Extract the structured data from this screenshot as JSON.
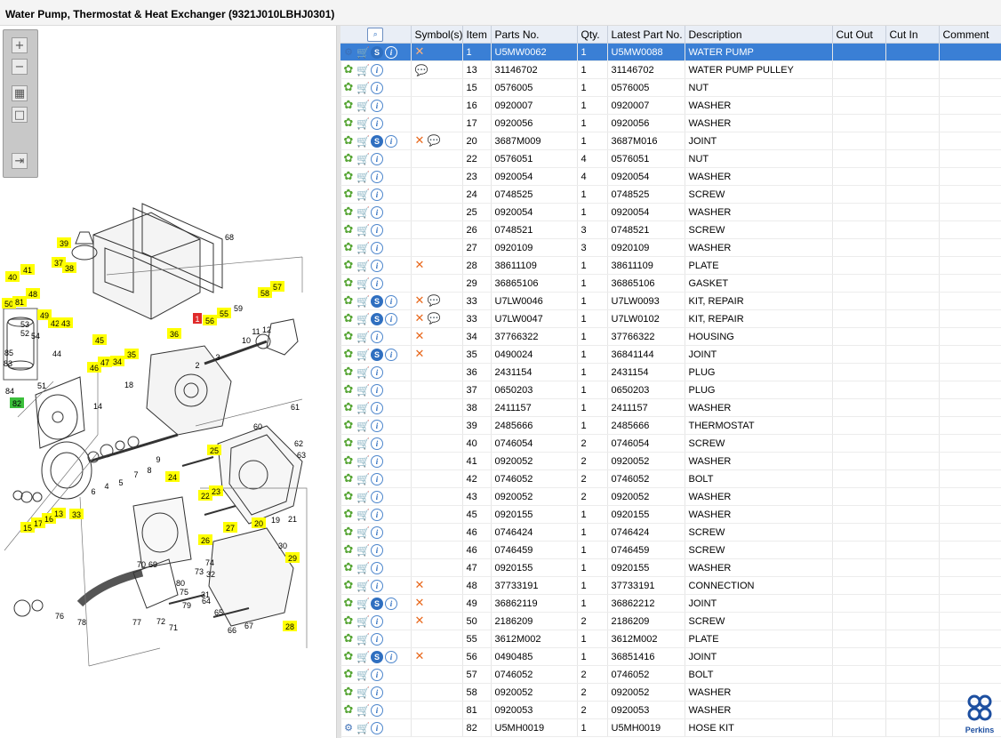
{
  "window": {
    "title": "Water Pump, Thermostat & Heat Exchanger (9321J010LBHJ0301)"
  },
  "toolbar": {
    "zoom_in_icon": "zoom-in-icon",
    "zoom_out_icon": "zoom-out-icon",
    "fit_icon": "fit-page-icon",
    "actual_icon": "actual-size-icon",
    "export_icon": "export-icon"
  },
  "diagram": {
    "highlighted_callouts": [
      "39",
      "41",
      "37",
      "38",
      "40",
      "48",
      "50",
      "81",
      "49",
      "42",
      "43",
      "45",
      "46",
      "47",
      "34",
      "35",
      "36",
      "56",
      "55",
      "58",
      "57",
      "82",
      "24",
      "25",
      "22",
      "23",
      "26",
      "27",
      "20",
      "29",
      "28",
      "15",
      "17",
      "16",
      "13",
      "33"
    ],
    "red_callout": "1",
    "plain_callouts": [
      "68",
      "59",
      "53",
      "52",
      "83",
      "84",
      "85",
      "51",
      "44",
      "54",
      "14",
      "18",
      "2",
      "3",
      "10",
      "11",
      "12",
      "4",
      "5",
      "6",
      "7",
      "8",
      "9",
      "61",
      "60",
      "62",
      "63",
      "19",
      "21",
      "30",
      "31",
      "32",
      "70",
      "69",
      "74",
      "73",
      "80",
      "64",
      "65",
      "66",
      "67",
      "71",
      "72",
      "75",
      "76",
      "77",
      "78",
      "79"
    ],
    "highlight_color": "#ffff00",
    "green_color": "#3bbf3b"
  },
  "table": {
    "headers": {
      "actions": "",
      "symbols": "Symbol(s)",
      "item": "Item",
      "parts_no": "Parts No.",
      "qty": "Qty.",
      "latest_part_no": "Latest Part No.",
      "description": "Description",
      "cut_out": "Cut Out",
      "cut_in": "Cut In",
      "comment": "Comment"
    },
    "rows": [
      {
        "item": "1",
        "parts_no": "U5MW0062",
        "qty": "1",
        "latest": "U5MW0088",
        "desc": "WATER PUMP",
        "s": true,
        "x": true,
        "p": false,
        "gear": "multi",
        "selected": true
      },
      {
        "item": "13",
        "parts_no": "31146702",
        "qty": "1",
        "latest": "31146702",
        "desc": "WATER PUMP PULLEY",
        "s": false,
        "x": false,
        "p": true,
        "gear": "single"
      },
      {
        "item": "15",
        "parts_no": "0576005",
        "qty": "1",
        "latest": "0576005",
        "desc": "NUT",
        "s": false,
        "x": false,
        "p": false,
        "gear": "single"
      },
      {
        "item": "16",
        "parts_no": "0920007",
        "qty": "1",
        "latest": "0920007",
        "desc": "WASHER",
        "s": false,
        "x": false,
        "p": false,
        "gear": "single"
      },
      {
        "item": "17",
        "parts_no": "0920056",
        "qty": "1",
        "latest": "0920056",
        "desc": "WASHER",
        "s": false,
        "x": false,
        "p": false,
        "gear": "single"
      },
      {
        "item": "20",
        "parts_no": "3687M009",
        "qty": "1",
        "latest": "3687M016",
        "desc": "JOINT",
        "s": true,
        "x": true,
        "p": true,
        "gear": "single"
      },
      {
        "item": "22",
        "parts_no": "0576051",
        "qty": "4",
        "latest": "0576051",
        "desc": "NUT",
        "s": false,
        "x": false,
        "p": false,
        "gear": "single"
      },
      {
        "item": "23",
        "parts_no": "0920054",
        "qty": "4",
        "latest": "0920054",
        "desc": "WASHER",
        "s": false,
        "x": false,
        "p": false,
        "gear": "single"
      },
      {
        "item": "24",
        "parts_no": "0748525",
        "qty": "1",
        "latest": "0748525",
        "desc": "SCREW",
        "s": false,
        "x": false,
        "p": false,
        "gear": "single"
      },
      {
        "item": "25",
        "parts_no": "0920054",
        "qty": "1",
        "latest": "0920054",
        "desc": "WASHER",
        "s": false,
        "x": false,
        "p": false,
        "gear": "single"
      },
      {
        "item": "26",
        "parts_no": "0748521",
        "qty": "3",
        "latest": "0748521",
        "desc": "SCREW",
        "s": false,
        "x": false,
        "p": false,
        "gear": "single"
      },
      {
        "item": "27",
        "parts_no": "0920109",
        "qty": "3",
        "latest": "0920109",
        "desc": "WASHER",
        "s": false,
        "x": false,
        "p": false,
        "gear": "single"
      },
      {
        "item": "28",
        "parts_no": "38611109",
        "qty": "1",
        "latest": "38611109",
        "desc": "PLATE",
        "s": false,
        "x": true,
        "p": false,
        "gear": "single"
      },
      {
        "item": "29",
        "parts_no": "36865106",
        "qty": "1",
        "latest": "36865106",
        "desc": "GASKET",
        "s": false,
        "x": false,
        "p": false,
        "gear": "single"
      },
      {
        "item": "33",
        "parts_no": "U7LW0046",
        "qty": "1",
        "latest": "U7LW0093",
        "desc": "KIT, REPAIR",
        "s": true,
        "x": true,
        "p": true,
        "gear": "single"
      },
      {
        "item": "33",
        "parts_no": "U7LW0047",
        "qty": "1",
        "latest": "U7LW0102",
        "desc": "KIT, REPAIR",
        "s": true,
        "x": true,
        "p": true,
        "gear": "single"
      },
      {
        "item": "34",
        "parts_no": "37766322",
        "qty": "1",
        "latest": "37766322",
        "desc": "HOUSING",
        "s": false,
        "x": true,
        "p": false,
        "gear": "single"
      },
      {
        "item": "35",
        "parts_no": "0490024",
        "qty": "1",
        "latest": "36841144",
        "desc": "JOINT",
        "s": true,
        "x": true,
        "p": false,
        "gear": "single"
      },
      {
        "item": "36",
        "parts_no": "2431154",
        "qty": "1",
        "latest": "2431154",
        "desc": "PLUG",
        "s": false,
        "x": false,
        "p": false,
        "gear": "single"
      },
      {
        "item": "37",
        "parts_no": "0650203",
        "qty": "1",
        "latest": "0650203",
        "desc": "PLUG",
        "s": false,
        "x": false,
        "p": false,
        "gear": "single"
      },
      {
        "item": "38",
        "parts_no": "2411157",
        "qty": "1",
        "latest": "2411157",
        "desc": "WASHER",
        "s": false,
        "x": false,
        "p": false,
        "gear": "single"
      },
      {
        "item": "39",
        "parts_no": "2485666",
        "qty": "1",
        "latest": "2485666",
        "desc": "THERMOSTAT",
        "s": false,
        "x": false,
        "p": false,
        "gear": "single"
      },
      {
        "item": "40",
        "parts_no": "0746054",
        "qty": "2",
        "latest": "0746054",
        "desc": "SCREW",
        "s": false,
        "x": false,
        "p": false,
        "gear": "single"
      },
      {
        "item": "41",
        "parts_no": "0920052",
        "qty": "2",
        "latest": "0920052",
        "desc": "WASHER",
        "s": false,
        "x": false,
        "p": false,
        "gear": "single"
      },
      {
        "item": "42",
        "parts_no": "0746052",
        "qty": "2",
        "latest": "0746052",
        "desc": "BOLT",
        "s": false,
        "x": false,
        "p": false,
        "gear": "single"
      },
      {
        "item": "43",
        "parts_no": "0920052",
        "qty": "2",
        "latest": "0920052",
        "desc": "WASHER",
        "s": false,
        "x": false,
        "p": false,
        "gear": "single"
      },
      {
        "item": "45",
        "parts_no": "0920155",
        "qty": "1",
        "latest": "0920155",
        "desc": "WASHER",
        "s": false,
        "x": false,
        "p": false,
        "gear": "single"
      },
      {
        "item": "46",
        "parts_no": "0746424",
        "qty": "1",
        "latest": "0746424",
        "desc": "SCREW",
        "s": false,
        "x": false,
        "p": false,
        "gear": "single"
      },
      {
        "item": "46",
        "parts_no": "0746459",
        "qty": "1",
        "latest": "0746459",
        "desc": "SCREW",
        "s": false,
        "x": false,
        "p": false,
        "gear": "single"
      },
      {
        "item": "47",
        "parts_no": "0920155",
        "qty": "1",
        "latest": "0920155",
        "desc": "WASHER",
        "s": false,
        "x": false,
        "p": false,
        "gear": "single"
      },
      {
        "item": "48",
        "parts_no": "37733191",
        "qty": "1",
        "latest": "37733191",
        "desc": "CONNECTION",
        "s": false,
        "x": true,
        "p": false,
        "gear": "single"
      },
      {
        "item": "49",
        "parts_no": "36862119",
        "qty": "1",
        "latest": "36862212",
        "desc": "JOINT",
        "s": true,
        "x": true,
        "p": false,
        "gear": "single"
      },
      {
        "item": "50",
        "parts_no": "2186209",
        "qty": "2",
        "latest": "2186209",
        "desc": "SCREW",
        "s": false,
        "x": true,
        "p": false,
        "gear": "single"
      },
      {
        "item": "55",
        "parts_no": "3612M002",
        "qty": "1",
        "latest": "3612M002",
        "desc": "PLATE",
        "s": false,
        "x": false,
        "p": false,
        "gear": "single"
      },
      {
        "item": "56",
        "parts_no": "0490485",
        "qty": "1",
        "latest": "36851416",
        "desc": "JOINT",
        "s": true,
        "x": true,
        "p": false,
        "gear": "single"
      },
      {
        "item": "57",
        "parts_no": "0746052",
        "qty": "2",
        "latest": "0746052",
        "desc": "BOLT",
        "s": false,
        "x": false,
        "p": false,
        "gear": "single"
      },
      {
        "item": "58",
        "parts_no": "0920052",
        "qty": "2",
        "latest": "0920052",
        "desc": "WASHER",
        "s": false,
        "x": false,
        "p": false,
        "gear": "single"
      },
      {
        "item": "81",
        "parts_no": "0920053",
        "qty": "2",
        "latest": "0920053",
        "desc": "WASHER",
        "s": false,
        "x": false,
        "p": false,
        "gear": "single"
      },
      {
        "item": "82",
        "parts_no": "U5MH0019",
        "qty": "1",
        "latest": "U5MH0019",
        "desc": "HOSE KIT",
        "s": false,
        "x": false,
        "p": false,
        "gear": "multi"
      }
    ]
  },
  "logo": {
    "text": "Perkins"
  }
}
